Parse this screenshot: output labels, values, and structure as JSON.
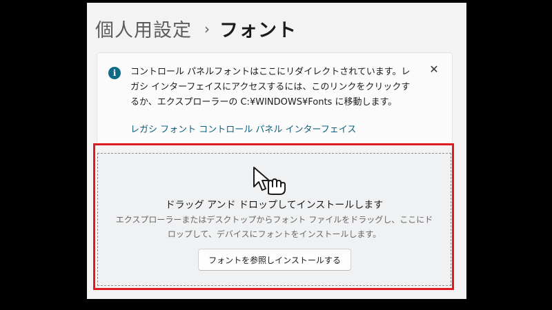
{
  "breadcrumb": {
    "parent": "個人用設定",
    "separator": "›",
    "current": "フォント"
  },
  "info_bar": {
    "icon": "info-icon",
    "message": "コントロール パネルフォントはここにリダイレクトされています。レガシ インターフェイスにアクセスするには、このリンクをクリックするか、エクスプローラーの C:¥WINDOWS¥Fonts に移動します。",
    "link": "レガシ フォント コントロール パネル インターフェイス",
    "close": "✕"
  },
  "drop_zone": {
    "icon": "drag-cursor-icon",
    "title": "ドラッグ アンド ドロップしてインストールします",
    "description": "エクスプローラーまたはデスクトップからフォント ファイルをドラッグし、ここにドロップして、デバイスにフォントをインストールします。",
    "button": "フォントを参照しインストールする"
  },
  "colors": {
    "highlight": "#e0191f",
    "link": "#0f5f7a",
    "info": "#0f6a85"
  }
}
